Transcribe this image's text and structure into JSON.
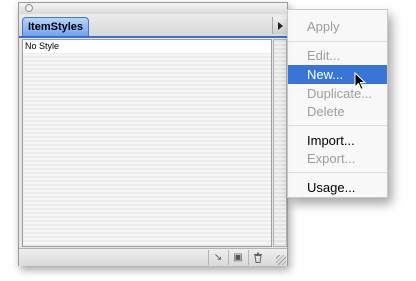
{
  "palette": {
    "tab_label": "ItemStyles",
    "list_items": [
      "No Style"
    ],
    "bottom_buttons": [
      {
        "icon": "redefine-style-icon",
        "glyph": "↘"
      },
      {
        "icon": "new-style-icon",
        "glyph": "▣"
      },
      {
        "icon": "trash-icon",
        "glyph": "🗑"
      }
    ]
  },
  "menu": {
    "items": [
      {
        "label": "Apply",
        "enabled": false
      },
      {
        "label": "Edit...",
        "enabled": false
      },
      {
        "label": "New...",
        "enabled": true,
        "selected": true
      },
      {
        "label": "Duplicate...",
        "enabled": false
      },
      {
        "label": "Delete",
        "enabled": false
      },
      {
        "label": "Import...",
        "enabled": true
      },
      {
        "label": "Export...",
        "enabled": false
      },
      {
        "label": "Usage...",
        "enabled": true
      }
    ]
  },
  "colors": {
    "selection": "#3875d7",
    "tab": "#8ab6f2",
    "disabled_text": "#9d9d9d"
  }
}
